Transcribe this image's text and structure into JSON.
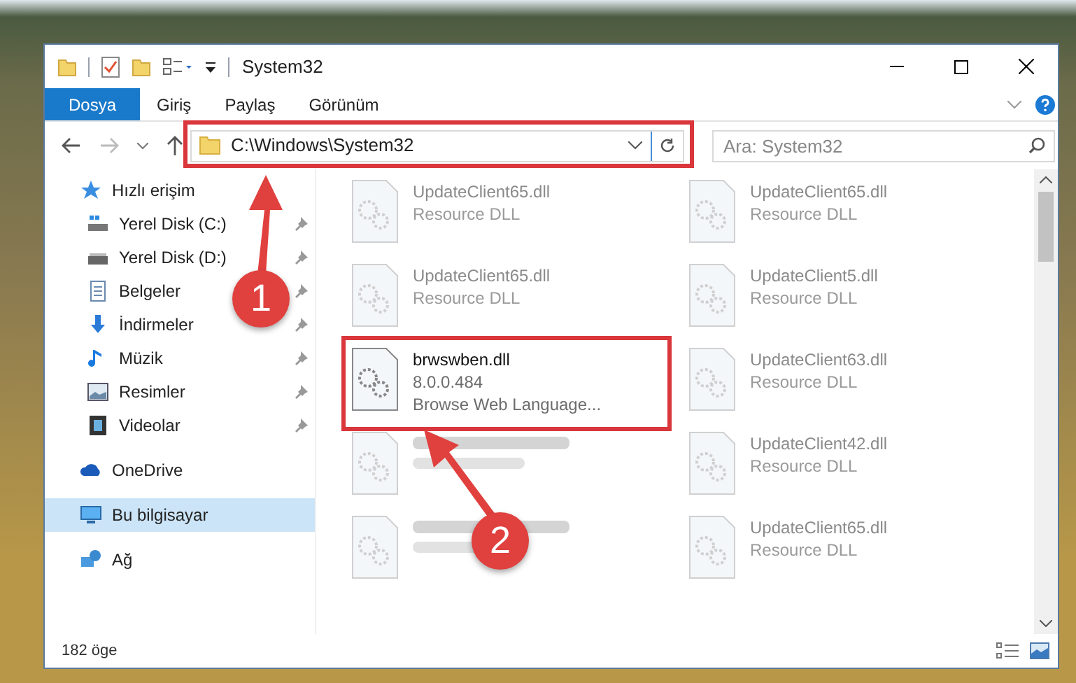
{
  "window": {
    "title": "System32"
  },
  "ribbon_tabs": [
    {
      "label": "Dosya",
      "selected": true
    },
    {
      "label": "Giriş",
      "selected": false
    },
    {
      "label": "Paylaş",
      "selected": false
    },
    {
      "label": "Görünüm",
      "selected": false
    }
  ],
  "address": {
    "path": "C:\\Windows\\System32"
  },
  "search": {
    "placeholder": "Ara: System32"
  },
  "nav": [
    {
      "label": "Hızlı erişim",
      "kind": "star",
      "selected": false,
      "children": [
        {
          "label": "Yerel Disk (C:)",
          "kind": "drive-c",
          "pinned": true,
          "selected": false
        },
        {
          "label": "Yerel Disk (D:)",
          "kind": "drive",
          "pinned": true,
          "selected": false
        },
        {
          "label": "Belgeler",
          "kind": "document",
          "pinned": true,
          "selected": false
        },
        {
          "label": "İndirmeler",
          "kind": "download",
          "pinned": true,
          "selected": false
        },
        {
          "label": "Müzik",
          "kind": "music",
          "pinned": true,
          "selected": false
        },
        {
          "label": "Resimler",
          "kind": "picture",
          "pinned": true,
          "selected": false
        },
        {
          "label": "Videolar",
          "kind": "video",
          "pinned": true,
          "selected": false
        }
      ]
    },
    {
      "label": "OneDrive",
      "kind": "cloud",
      "selected": false
    },
    {
      "label": "Bu bilgisayar",
      "kind": "computer",
      "selected": true
    },
    {
      "label": "Ağ",
      "kind": "network",
      "selected": false
    }
  ],
  "files": [
    {
      "name": "UpdateClient65.dll",
      "lines": [
        "Resource DLL"
      ],
      "blurred": true
    },
    {
      "name": "UpdateClient65.dll",
      "lines": [
        "Resource DLL"
      ],
      "blurred": true
    },
    {
      "name": "UpdateClient65.dll",
      "lines": [
        "Resource DLL"
      ],
      "blurred": true
    },
    {
      "name": "UpdateClient5.dll",
      "lines": [
        "Resource DLL"
      ],
      "blurred": true
    },
    {
      "name": "brwswben.dll",
      "lines": [
        "8.0.0.484",
        "Browse Web Language..."
      ],
      "blurred": false
    },
    {
      "name": "UpdateClient63.dll",
      "lines": [
        "Resource DLL"
      ],
      "blurred": true
    },
    {
      "blurred": true
    },
    {
      "name": "UpdateClient42.dll",
      "lines": [
        "Resource DLL"
      ],
      "blurred": true
    },
    {
      "blurred": true
    },
    {
      "name": "UpdateClient65.dll",
      "lines": [
        "Resource DLL"
      ],
      "blurred": true
    }
  ],
  "status_bar": {
    "count": "182 öge"
  },
  "annotations": [
    {
      "number": "1"
    },
    {
      "number": "2"
    }
  ]
}
